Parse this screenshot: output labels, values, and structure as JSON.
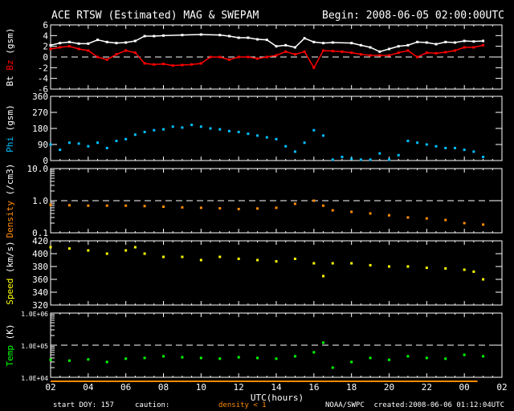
{
  "title": "ACE RTSW (Estimated) MAG & SWEPAM",
  "begin": "Begin: 2008-06-05 02:00:00UTC",
  "footer": {
    "start_doy": "start DOY: 157",
    "caution": "caution:",
    "density_note": "density < 1",
    "source": "NOAA/SWPC",
    "created": "created:2008-06-06 01:12:04UTC"
  },
  "colors": {
    "bt": "#ffffff",
    "bz": "#ff0000",
    "phi": "#00bfff",
    "density": "#ff8c00",
    "speed": "#ffff00",
    "temp": "#00ff00"
  },
  "chart_data": [
    {
      "type": "line",
      "ylabel_parts": [
        "Bt",
        "Bz",
        "(gsm)"
      ],
      "ylim": [
        -6,
        6
      ],
      "yticks": [
        "6",
        "4",
        "2",
        "0",
        "-2",
        "-4",
        "-6"
      ],
      "ytick_values": [
        6,
        4,
        2,
        0,
        -2,
        -4,
        -6
      ],
      "reference": 0,
      "xlabel": "UTC(hours)",
      "x_tick_labels": [
        "02",
        "04",
        "06",
        "08",
        "10",
        "12",
        "14",
        "16",
        "18",
        "20",
        "22",
        "00",
        "02"
      ],
      "xlim_hours": [
        0,
        24
      ],
      "series": [
        {
          "name": "Bt",
          "color_key": "bt",
          "x": [
            0,
            0.5,
            1,
            1.5,
            2,
            2.5,
            3,
            3.5,
            4,
            4.5,
            5,
            5.5,
            6,
            7,
            8,
            9,
            9.5,
            10,
            10.5,
            11,
            11.5,
            12,
            12.5,
            13,
            13.5,
            14,
            14.5,
            15,
            16,
            16.5,
            17,
            17.5,
            18,
            18.5,
            19,
            19.5,
            20,
            20.5,
            21,
            21.5,
            22,
            22.5,
            23
          ],
          "values": [
            2.2,
            2.6,
            2.8,
            2.5,
            2.5,
            3.2,
            2.8,
            2.6,
            2.7,
            3.0,
            3.9,
            3.9,
            4.0,
            4.1,
            4.2,
            4.1,
            3.9,
            3.6,
            3.6,
            3.3,
            3.2,
            2.0,
            2.2,
            1.8,
            3.5,
            2.8,
            2.6,
            2.7,
            2.6,
            2.2,
            1.8,
            1.0,
            1.5,
            2.0,
            2.2,
            2.8,
            2.7,
            2.4,
            2.8,
            2.7,
            3.0,
            2.9,
            3.0
          ]
        },
        {
          "name": "Bz",
          "color_key": "bz",
          "x": [
            0,
            0.5,
            1,
            1.5,
            2,
            2.5,
            3,
            3.5,
            4,
            4.5,
            5,
            5.5,
            6,
            6.5,
            7,
            7.5,
            8,
            8.5,
            9,
            9.5,
            10,
            10.5,
            11,
            11.5,
            12,
            12.5,
            13,
            13.5,
            14,
            14.5,
            15,
            15.5,
            16,
            16.5,
            17,
            17.5,
            18,
            18.5,
            19,
            19.5,
            20,
            20.5,
            21,
            21.5,
            22,
            22.5,
            23
          ],
          "values": [
            1.5,
            1.8,
            2.0,
            1.5,
            1.2,
            0,
            -0.5,
            0.5,
            1.2,
            0.8,
            -1.2,
            -1.4,
            -1.3,
            -1.6,
            -1.5,
            -1.4,
            -1.2,
            0,
            0,
            -0.5,
            0,
            0,
            -0.3,
            0,
            0.3,
            1.0,
            0.5,
            1.0,
            -2.0,
            1.2,
            1.1,
            1.0,
            0.8,
            0.5,
            0.3,
            0.3,
            0.3,
            0.8,
            1.2,
            0,
            0.8,
            0.7,
            0.9,
            1.2,
            1.8,
            1.8,
            2.2
          ]
        }
      ]
    },
    {
      "type": "scatter",
      "ylabel": "Phi (gsm)",
      "ylim": [
        0,
        360
      ],
      "yticks": [
        "360",
        "270",
        "180",
        "90",
        "0"
      ],
      "ytick_values": [
        360,
        270,
        180,
        90,
        0
      ],
      "series": [
        {
          "name": "Phi",
          "color_key": "phi",
          "x": [
            0,
            0.5,
            1,
            1.5,
            2,
            2.5,
            3,
            3.5,
            4,
            4.5,
            5,
            5.5,
            6,
            6.5,
            7,
            7.5,
            8,
            8.5,
            9,
            9.5,
            10,
            10.5,
            11,
            11.5,
            12,
            12.5,
            13,
            13.5,
            14,
            14.5,
            15,
            15.5,
            16,
            16.5,
            17,
            17.5,
            18,
            18.5,
            19,
            19.5,
            20,
            20.5,
            21,
            21.5,
            22,
            22.5,
            23
          ],
          "values": [
            90,
            60,
            100,
            95,
            80,
            100,
            70,
            110,
            120,
            145,
            160,
            170,
            175,
            190,
            185,
            200,
            190,
            180,
            175,
            165,
            160,
            150,
            140,
            130,
            120,
            80,
            50,
            100,
            170,
            140,
            5,
            20,
            10,
            5,
            5,
            40,
            5,
            30,
            110,
            100,
            90,
            80,
            70,
            70,
            60,
            50,
            20
          ]
        }
      ]
    },
    {
      "type": "scatter",
      "ylabel": "Density (/cm3)",
      "scale": "log",
      "ylim": [
        0.1,
        10
      ],
      "yticks": [
        "10.0",
        "1.0",
        "0.1"
      ],
      "ytick_values": [
        10,
        1,
        0.1
      ],
      "reference": 1,
      "series": [
        {
          "name": "Density",
          "color_key": "density",
          "x": [
            0,
            1,
            2,
            3,
            4,
            5,
            6,
            7,
            8,
            9,
            10,
            11,
            12,
            13,
            14,
            14.5,
            15,
            16,
            17,
            18,
            19,
            20,
            21,
            22,
            23
          ],
          "values": [
            0.75,
            0.72,
            0.7,
            0.7,
            0.7,
            0.68,
            0.65,
            0.62,
            0.6,
            0.58,
            0.55,
            0.57,
            0.6,
            0.8,
            1.0,
            0.7,
            0.5,
            0.45,
            0.4,
            0.35,
            0.3,
            0.28,
            0.25,
            0.2,
            0.18
          ]
        }
      ]
    },
    {
      "type": "scatter",
      "ylabel": "Speed (km/s)",
      "ylim": [
        320,
        420
      ],
      "yticks": [
        "420",
        "400",
        "380",
        "360",
        "340",
        "320"
      ],
      "ytick_values": [
        420,
        400,
        380,
        360,
        340,
        320
      ],
      "series": [
        {
          "name": "Speed",
          "color_key": "speed",
          "x": [
            0,
            1,
            2,
            3,
            4,
            4.5,
            5,
            6,
            7,
            8,
            9,
            10,
            11,
            12,
            13,
            14,
            14.5,
            15,
            16,
            17,
            18,
            19,
            20,
            21,
            22,
            22.5,
            23
          ],
          "values": [
            410,
            408,
            405,
            400,
            405,
            410,
            400,
            395,
            395,
            390,
            395,
            392,
            390,
            388,
            392,
            385,
            365,
            385,
            385,
            382,
            380,
            380,
            378,
            377,
            375,
            372,
            360
          ]
        }
      ]
    },
    {
      "type": "scatter",
      "ylabel": "Temp (K)",
      "scale": "log",
      "ylim": [
        10000,
        1000000
      ],
      "yticks": [
        "1.0E+06",
        "1.0E+05",
        "1.0E+04"
      ],
      "ytick_values": [
        1000000,
        100000,
        10000
      ],
      "reference": 100000,
      "series": [
        {
          "name": "Temp",
          "color_key": "temp",
          "x": [
            0,
            1,
            2,
            3,
            4,
            5,
            6,
            7,
            8,
            9,
            10,
            11,
            12,
            13,
            14,
            14.5,
            15,
            16,
            17,
            18,
            19,
            20,
            21,
            22,
            23
          ],
          "values": [
            35000,
            33000,
            36000,
            30000,
            38000,
            40000,
            45000,
            42000,
            40000,
            38000,
            42000,
            40000,
            38000,
            45000,
            60000,
            120000,
            20000,
            30000,
            40000,
            35000,
            45000,
            40000,
            38000,
            50000,
            45000
          ]
        }
      ]
    }
  ]
}
